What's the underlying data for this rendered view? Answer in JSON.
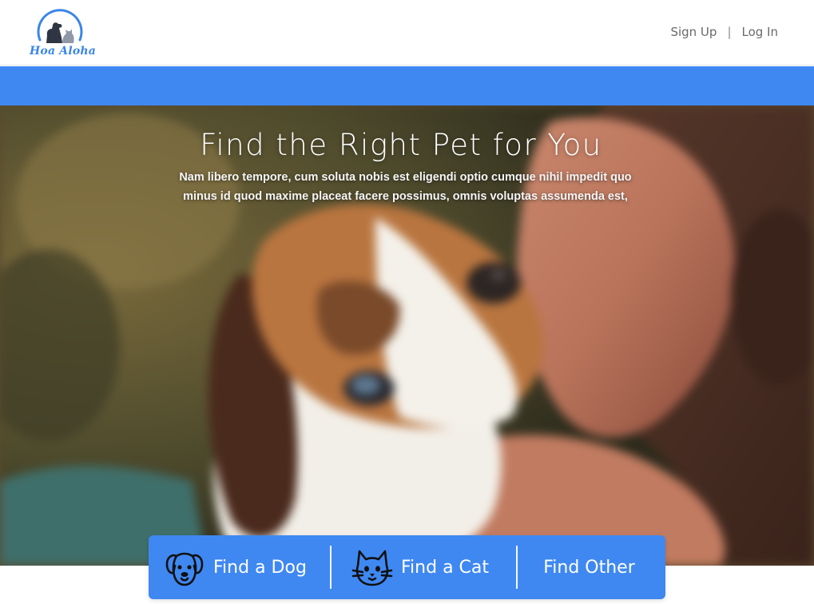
{
  "brand": {
    "name": "Hoa Aloha",
    "logo_icon": "cat-and-dog-logo-icon",
    "accent": "#3f88f2"
  },
  "header": {
    "sign_up": "Sign Up",
    "separator": "|",
    "log_in": "Log In"
  },
  "hero": {
    "title": "Find the Right Pet for You",
    "subtitle": "Nam libero tempore, cum soluta nobis est eligendi optio cumque nihil impedit quo minus id quod maxime placeat facere possimus, omnis voluptas assumenda est,",
    "image": "beagle-puppy-photo"
  },
  "find": {
    "dog": {
      "label": "Find a Dog",
      "icon": "dog-face-icon"
    },
    "cat": {
      "label": "Find a Cat",
      "icon": "cat-face-icon"
    },
    "other": {
      "label": "Find Other"
    }
  }
}
